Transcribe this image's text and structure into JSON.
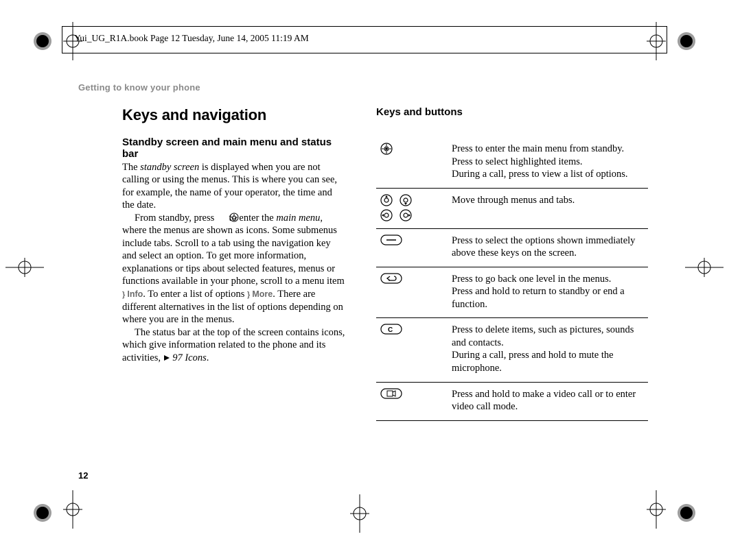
{
  "header": {
    "running_head": "Yui_UG_R1A.book  Page 12  Tuesday, June 14, 2005  11:19 AM"
  },
  "section_label": "Getting to know your phone",
  "left": {
    "title": "Keys and navigation",
    "subtitle": "Standby screen and main menu and status bar",
    "p1a": "The ",
    "p1_em": "standby screen",
    "p1b": " is displayed when you are not calling or using the menus. This is where you can see, for example, the name of your operator, the time and the date.",
    "p2a": "From standby, press ",
    "p2b": " to enter the ",
    "p2_em": "main menu",
    "p2c": ", where the menus are shown as icons. Some submenus include tabs. Scroll to a tab using the navigation key and select an option. To get more information, explanations or tips about selected features, menus or functions available in your phone, scroll to a menu item ",
    "info_label": "Info",
    "p2d": ". To enter a list of options ",
    "more_label": "More",
    "p2e": ". There are different alternatives in the list of options depending on where you are in the menus.",
    "p3a": "The status bar at the top of the screen contains icons, which give information related to the phone and its activities, ",
    "p3_xref": "97 Icons",
    "p3b": "."
  },
  "right": {
    "title": "Keys and buttons",
    "rows": [
      {
        "icon": "center",
        "desc": "Press to enter the main menu from standby.\nPress to select highlighted items.\nDuring a call, press to view a list of options."
      },
      {
        "icon": "dpad",
        "desc": "Move through menus and tabs."
      },
      {
        "icon": "softkey",
        "desc": "Press to select the options shown immediately above these keys on the screen."
      },
      {
        "icon": "back",
        "desc": "Press to go back one level in the menus.\nPress and hold to return to standby or end a function."
      },
      {
        "icon": "c",
        "desc": "Press to delete items, such as pictures, sounds and contacts.\nDuring a call, press and hold to mute the microphone."
      },
      {
        "icon": "video",
        "desc": "Press and hold to make a video call or to enter video call mode."
      }
    ]
  },
  "page_number": "12"
}
